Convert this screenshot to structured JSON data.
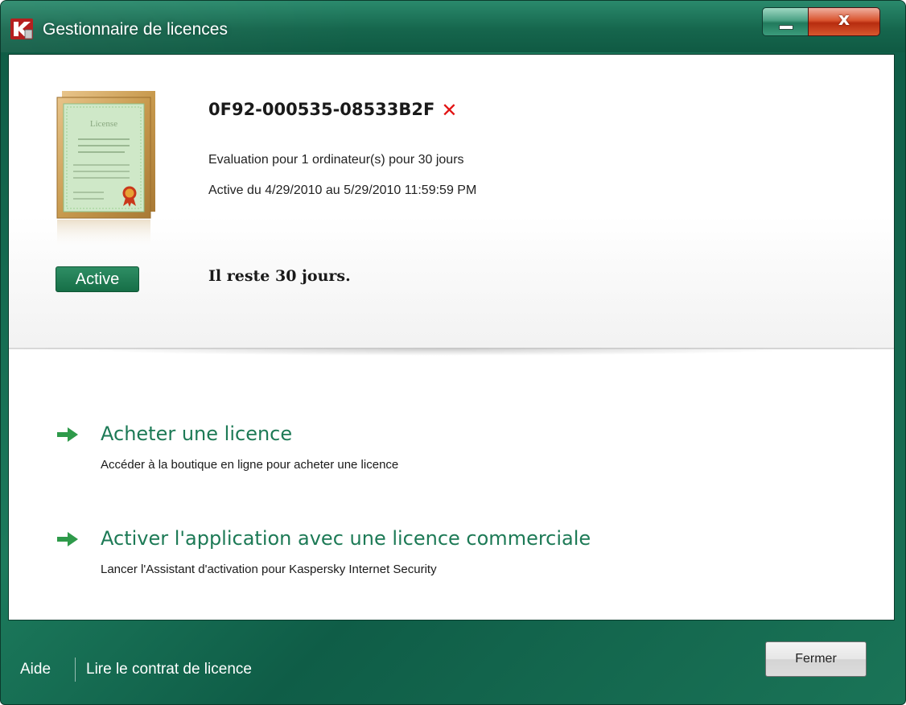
{
  "window": {
    "title": "Gestionnaire de licences",
    "close_glyph": "x",
    "accent": "#1d7a56"
  },
  "license": {
    "status_badge": "Active",
    "key": "0F92-000535-08533B2F",
    "key_status_glyph": "✕",
    "detail_type": "Evaluation pour 1 ordinateur(s) pour 30 jours",
    "detail_dates": "Active du 4/29/2010 au 5/29/2010 11:59:59 PM",
    "remaining": "Il reste 30 jours.",
    "icon": "license-certificate-icon",
    "certificate_caption": "License"
  },
  "actions": [
    {
      "title": "Acheter une licence",
      "description": "Accéder à la boutique en ligne pour acheter une licence",
      "icon": "green-arrow-icon"
    },
    {
      "title": "Activer l'application avec une licence commerciale",
      "description": "Lancer l'Assistant d'activation pour Kaspersky Internet Security",
      "icon": "green-arrow-icon"
    }
  ],
  "footer": {
    "help_label": "Aide",
    "agreement_label": "Lire le contrat de licence",
    "close_button_label": "Fermer"
  }
}
